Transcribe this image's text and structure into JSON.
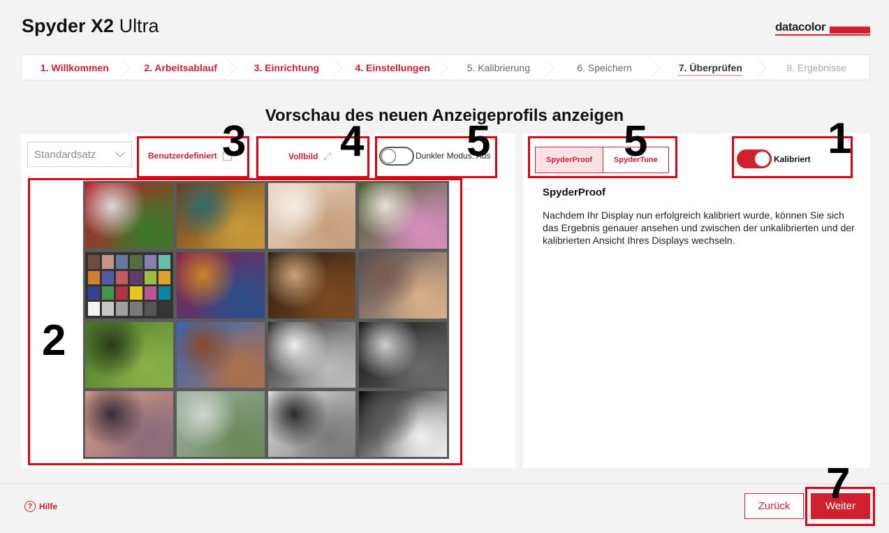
{
  "app": {
    "title_bold": "Spyder X2",
    "title_light": " Ultra",
    "logo_text": "datacolor"
  },
  "steps": [
    {
      "label": "1. Willkommen",
      "state": "done"
    },
    {
      "label": "2. Arbeitsablauf",
      "state": "done"
    },
    {
      "label": "3. Einrichtung",
      "state": "done"
    },
    {
      "label": "4. Einstellungen",
      "state": "done"
    },
    {
      "label": "5. Kalibrierung",
      "state": "pending"
    },
    {
      "label": "6. Speichern",
      "state": "pending"
    },
    {
      "label": "7. Überprüfen",
      "state": "active"
    },
    {
      "label": "8. Ergebnisse",
      "state": "future"
    }
  ],
  "heading": "Vorschau des neuen Anzeigeprofils anzeigen",
  "toolbar": {
    "preset_select": {
      "value": "Standardsatz"
    },
    "custom_label": "Benutzerdefiniert",
    "fullscreen_label": "Vollbild",
    "dark_mode_label": "Dunkler Modus: Aus",
    "dark_mode_on": false
  },
  "images": [
    {
      "name": "peppers",
      "colors": [
        "#c0172a",
        "#3a7a2a",
        "#d9d9d9"
      ]
    },
    {
      "name": "plates",
      "colors": [
        "#6b3b1c",
        "#c99a3a",
        "#2d6b6b"
      ]
    },
    {
      "name": "portrait-woman",
      "colors": [
        "#e9d8c8",
        "#c79f7e",
        "#f5efe6"
      ]
    },
    {
      "name": "girl-flowers",
      "colors": [
        "#3c5a24",
        "#d98fbf",
        "#e8e0d8"
      ]
    },
    {
      "name": "color-checker",
      "colors": []
    },
    {
      "name": "fabrics",
      "colors": [
        "#8a1d4a",
        "#2a4e8a",
        "#c9842a"
      ]
    },
    {
      "name": "cellist",
      "colors": [
        "#2a1a10",
        "#7a4a24",
        "#c9a27a"
      ]
    },
    {
      "name": "dancer-street",
      "colors": [
        "#4a4a52",
        "#d9b08a",
        "#7a5a52"
      ]
    },
    {
      "name": "garden-vase",
      "colors": [
        "#4a7a2a",
        "#8ab04a",
        "#2a3a1a"
      ]
    },
    {
      "name": "church",
      "colors": [
        "#2a6ac9",
        "#b0704a",
        "#8a4a2a"
      ]
    },
    {
      "name": "bw-portrait",
      "colors": [
        "#2a2a2a",
        "#bdbdbd",
        "#f0f0f0"
      ]
    },
    {
      "name": "spiral-stairs",
      "colors": [
        "#111111",
        "#6a6a6a",
        "#cfcfcf"
      ]
    },
    {
      "name": "sunset-hills",
      "colors": [
        "#d9a08a",
        "#8a6a7a",
        "#3a2a3a"
      ]
    },
    {
      "name": "tuscany",
      "colors": [
        "#a0b0a0",
        "#6a8a5a",
        "#d0d6d0"
      ]
    },
    {
      "name": "bw-scooter",
      "colors": [
        "#e0e0e0",
        "#7a7a7a",
        "#2a2a2a"
      ]
    },
    {
      "name": "bw-test",
      "colors": [
        "#050505",
        "#f0f0f0",
        "#5a5a5a"
      ]
    }
  ],
  "checker_colors": [
    "#734b3c",
    "#c29682",
    "#627a9d",
    "#576c43",
    "#8580b1",
    "#67bdaa",
    "#d67e2c",
    "#505ba6",
    "#c15a63",
    "#5e3c6c",
    "#9dbc40",
    "#e0a32e",
    "#383d96",
    "#469449",
    "#af363c",
    "#e7c71f",
    "#bb5695",
    "#0885a1",
    "#f3f3f2",
    "#c8c8c8",
    "#a0a0a0",
    "#7a7a79",
    "#555555",
    "#343434"
  ],
  "right": {
    "tabs": [
      {
        "label": "SpyderProof",
        "active": true
      },
      {
        "label": "SpyderTune",
        "active": false
      }
    ],
    "calibrated_label": "Kalibriert",
    "calibrated_on": true,
    "section_title": "SpyderProof",
    "section_desc": "Nachdem Ihr Display nun erfolgreich kalibriert wurde, können Sie sich das Ergebnis genauer ansehen und zwischen der unkalibrierten und der kalibrierten Ansicht Ihres Displays wechseln."
  },
  "footer": {
    "help_label": "Hilfe",
    "back_label": "Zurück",
    "next_label": "Weiter"
  },
  "annotations": [
    "1",
    "2",
    "3",
    "4",
    "5",
    "5",
    "7"
  ],
  "colors": {
    "accent": "#d0202f",
    "highlight": "#e00010"
  }
}
